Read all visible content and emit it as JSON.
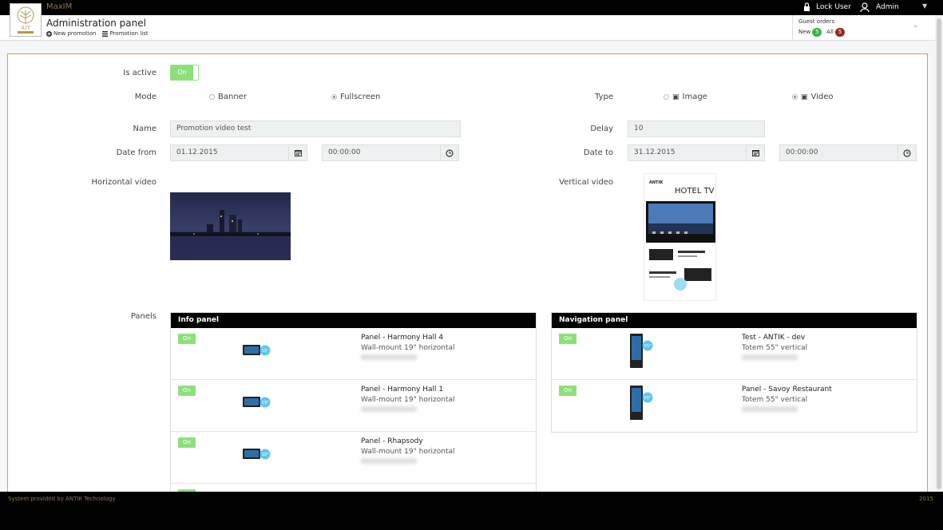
{
  "topbar": {
    "app_name": "MaxIM",
    "lock_user": "Lock User",
    "user_name": "Admin"
  },
  "header": {
    "title": "Administration panel",
    "links": [
      "New promotion",
      "Promotion list"
    ]
  },
  "guest_orders": {
    "title": "Guest orders",
    "new_label": "New",
    "new_count": "5",
    "all_label": "All",
    "all_count": "5"
  },
  "form": {
    "is_active_label": "Is active",
    "is_active_value": "On",
    "mode_label": "Mode",
    "mode_options": [
      "Banner",
      "Fullscreen"
    ],
    "mode_selected": "Fullscreen",
    "type_label": "Type",
    "type_options": [
      "Image",
      "Video"
    ],
    "type_selected": "Video",
    "name_label": "Name",
    "name_value": "Promotion video test",
    "delay_label": "Delay",
    "delay_value": "10",
    "date_from_label": "Date from",
    "date_from_value": "01.12.2015",
    "time_from_value": "00:00:00",
    "date_to_label": "Date to",
    "date_to_value": "31.12.2015",
    "time_to_value": "00:00:00",
    "horizontal_video_label": "Horizontal video",
    "vertical_video_label": "Vertical video",
    "vertical_video_text": [
      "HOTEL TV",
      "ANTIK"
    ],
    "panels_label": "Panels"
  },
  "info_panel": {
    "title": "Info panel",
    "rows": [
      {
        "toggle": "On",
        "name": "Panel - Harmony Hall 4",
        "type": "Wall-mount 19\" horizontal"
      },
      {
        "toggle": "On",
        "name": "Panel - Harmony Hall 1",
        "type": "Wall-mount 19\" horizontal"
      },
      {
        "toggle": "On",
        "name": "Panel - Rhapsody",
        "type": "Wall-mount 19\" horizontal"
      },
      {
        "toggle": "On",
        "name": "",
        "type": ""
      }
    ]
  },
  "navigation_panel": {
    "title": "Navigation panel",
    "rows": [
      {
        "toggle": "On",
        "name": "Test - ANTIK - dev",
        "type": "Totem 55\" vertical"
      },
      {
        "toggle": "On",
        "name": "Panel - Savoy Restaurant",
        "type": "Totem 55\" vertical"
      }
    ]
  },
  "footer": {
    "left": "System provided by ANTIK Technology",
    "right": "2015"
  },
  "colors": {
    "accent_gold": "#c8a45a",
    "toggle_green": "#8ce07a",
    "badge_green": "#3cb44b",
    "badge_red": "#8b2e1e"
  }
}
